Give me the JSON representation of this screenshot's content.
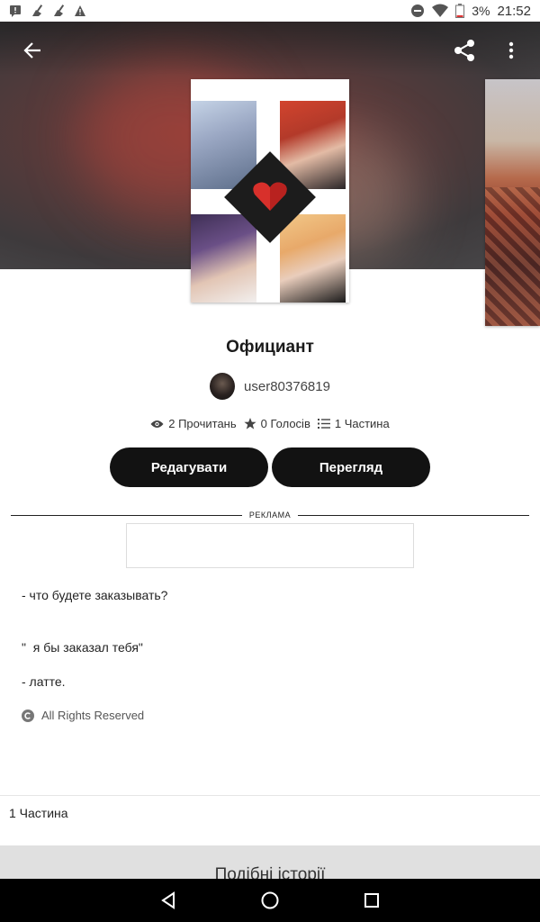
{
  "status_bar": {
    "battery": "3%",
    "time": "21:52",
    "left_icons": [
      "message-alert-icon",
      "broom-icon",
      "broom-icon",
      "warning-icon"
    ],
    "right_icons": [
      "do-not-disturb-icon",
      "wifi-icon",
      "battery-icon"
    ]
  },
  "header": {
    "back_icon": "arrow-back-icon",
    "share_icon": "share-icon",
    "more_icon": "more-vertical-icon"
  },
  "story": {
    "title": "Официант",
    "author": "user80376819",
    "stats": {
      "reads": "2 Прочитань",
      "votes": "0 Голосів",
      "parts": "1 Частина"
    },
    "buttons": {
      "edit": "Редагувати",
      "view": "Перегляд"
    },
    "ad_label": "РЕКЛАМА",
    "lines": [
      "- что будете заказывать?",
      "\"  я бы заказал тебя\"",
      "- латте."
    ],
    "rights": "All Rights Reserved",
    "part_label": "1 Частина",
    "similar_title": "Подібні історії"
  },
  "colors": {
    "button_bg": "#121212",
    "button_text": "#ffffff",
    "similar_bg": "#e0e0e0"
  },
  "nav": {
    "back_icon": "triangle-back-icon",
    "home_icon": "circle-home-icon",
    "recents_icon": "square-recents-icon"
  }
}
